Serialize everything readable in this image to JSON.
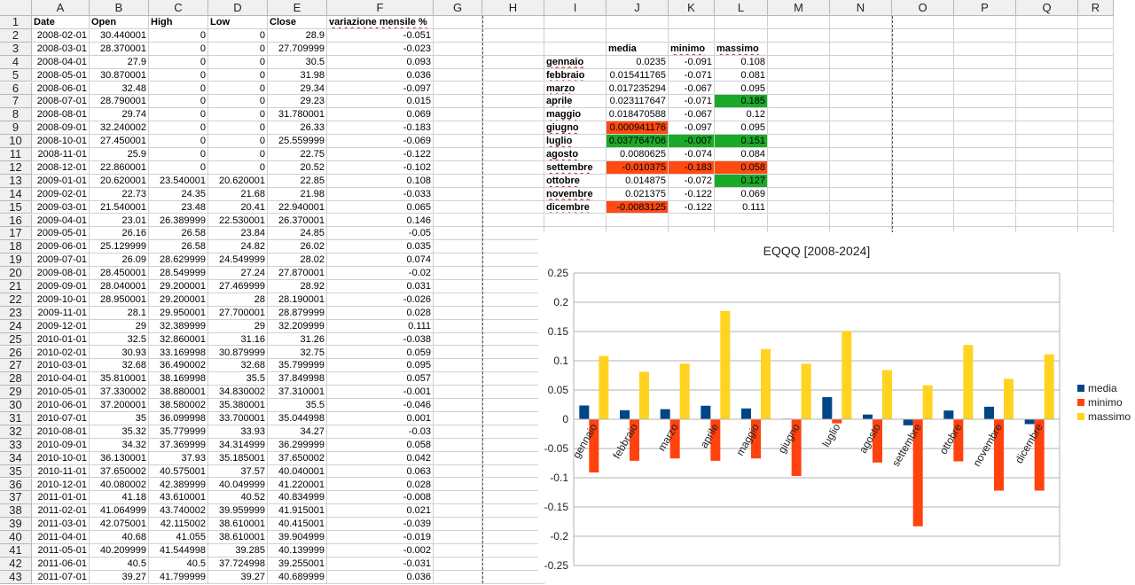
{
  "columns": [
    "A",
    "B",
    "C",
    "D",
    "E",
    "F",
    "G",
    "H",
    "I",
    "J",
    "K",
    "L",
    "M",
    "N",
    "O",
    "P",
    "Q",
    "R"
  ],
  "column_widths": [
    65,
    67,
    67,
    67,
    67,
    120,
    55,
    70,
    70,
    70,
    52,
    60,
    70,
    70,
    70,
    70,
    70,
    40
  ],
  "row_numbers": [
    "1",
    "2",
    "3",
    "4",
    "5",
    "6",
    "7",
    "8",
    "9",
    "10",
    "11",
    "12",
    "13",
    "14",
    "15",
    "16",
    "17",
    "18",
    "19",
    "20",
    "21",
    "22",
    "23",
    "24",
    "25",
    "26",
    "27",
    "28",
    "29",
    "30",
    "31",
    "32",
    "33",
    "34",
    "35",
    "36",
    "37",
    "38",
    "39",
    "40",
    "41",
    "42",
    "43"
  ],
  "headers": [
    "Date",
    "Open",
    "High",
    "Low",
    "Close",
    "variazione mensile %"
  ],
  "rows": [
    [
      "2008-02-01",
      "30.440001",
      "0",
      "0",
      "28.9",
      "-0.051"
    ],
    [
      "2008-03-01",
      "28.370001",
      "0",
      "0",
      "27.709999",
      "-0.023"
    ],
    [
      "2008-04-01",
      "27.9",
      "0",
      "0",
      "30.5",
      "0.093"
    ],
    [
      "2008-05-01",
      "30.870001",
      "0",
      "0",
      "31.98",
      "0.036"
    ],
    [
      "2008-06-01",
      "32.48",
      "0",
      "0",
      "29.34",
      "-0.097"
    ],
    [
      "2008-07-01",
      "28.790001",
      "0",
      "0",
      "29.23",
      "0.015"
    ],
    [
      "2008-08-01",
      "29.74",
      "0",
      "0",
      "31.780001",
      "0.069"
    ],
    [
      "2008-09-01",
      "32.240002",
      "0",
      "0",
      "26.33",
      "-0.183"
    ],
    [
      "2008-10-01",
      "27.450001",
      "0",
      "0",
      "25.559999",
      "-0.069"
    ],
    [
      "2008-11-01",
      "25.9",
      "0",
      "0",
      "22.75",
      "-0.122"
    ],
    [
      "2008-12-01",
      "22.860001",
      "0",
      "0",
      "20.52",
      "-0.102"
    ],
    [
      "2009-01-01",
      "20.620001",
      "23.540001",
      "20.620001",
      "22.85",
      "0.108"
    ],
    [
      "2009-02-01",
      "22.73",
      "24.35",
      "21.68",
      "21.98",
      "-0.033"
    ],
    [
      "2009-03-01",
      "21.540001",
      "23.48",
      "20.41",
      "22.940001",
      "0.065"
    ],
    [
      "2009-04-01",
      "23.01",
      "26.389999",
      "22.530001",
      "26.370001",
      "0.146"
    ],
    [
      "2009-05-01",
      "26.16",
      "26.58",
      "23.84",
      "24.85",
      "-0.05"
    ],
    [
      "2009-06-01",
      "25.129999",
      "26.58",
      "24.82",
      "26.02",
      "0.035"
    ],
    [
      "2009-07-01",
      "26.09",
      "28.629999",
      "24.549999",
      "28.02",
      "0.074"
    ],
    [
      "2009-08-01",
      "28.450001",
      "28.549999",
      "27.24",
      "27.870001",
      "-0.02"
    ],
    [
      "2009-09-01",
      "28.040001",
      "29.200001",
      "27.469999",
      "28.92",
      "0.031"
    ],
    [
      "2009-10-01",
      "28.950001",
      "29.200001",
      "28",
      "28.190001",
      "-0.026"
    ],
    [
      "2009-11-01",
      "28.1",
      "29.950001",
      "27.700001",
      "28.879999",
      "0.028"
    ],
    [
      "2009-12-01",
      "29",
      "32.389999",
      "29",
      "32.209999",
      "0.111"
    ],
    [
      "2010-01-01",
      "32.5",
      "32.860001",
      "31.16",
      "31.26",
      "-0.038"
    ],
    [
      "2010-02-01",
      "30.93",
      "33.169998",
      "30.879999",
      "32.75",
      "0.059"
    ],
    [
      "2010-03-01",
      "32.68",
      "36.490002",
      "32.68",
      "35.799999",
      "0.095"
    ],
    [
      "2010-04-01",
      "35.810001",
      "38.169998",
      "35.5",
      "37.849998",
      "0.057"
    ],
    [
      "2010-05-01",
      "37.330002",
      "38.880001",
      "34.830002",
      "37.310001",
      "-0.001"
    ],
    [
      "2010-06-01",
      "37.200001",
      "38.580002",
      "35.380001",
      "35.5",
      "-0.046"
    ],
    [
      "2010-07-01",
      "35",
      "36.099998",
      "33.700001",
      "35.044998",
      "0.001"
    ],
    [
      "2010-08-01",
      "35.32",
      "35.779999",
      "33.93",
      "34.27",
      "-0.03"
    ],
    [
      "2010-09-01",
      "34.32",
      "37.369999",
      "34.314999",
      "36.299999",
      "0.058"
    ],
    [
      "2010-10-01",
      "36.130001",
      "37.93",
      "35.185001",
      "37.650002",
      "0.042"
    ],
    [
      "2010-11-01",
      "37.650002",
      "40.575001",
      "37.57",
      "40.040001",
      "0.063"
    ],
    [
      "2010-12-01",
      "40.080002",
      "42.389999",
      "40.049999",
      "41.220001",
      "0.028"
    ],
    [
      "2011-01-01",
      "41.18",
      "43.610001",
      "40.52",
      "40.834999",
      "-0.008"
    ],
    [
      "2011-02-01",
      "41.064999",
      "43.740002",
      "39.959999",
      "41.915001",
      "0.021"
    ],
    [
      "2011-03-01",
      "42.075001",
      "42.115002",
      "38.610001",
      "40.415001",
      "-0.039"
    ],
    [
      "2011-04-01",
      "40.68",
      "41.055",
      "38.610001",
      "39.904999",
      "-0.019"
    ],
    [
      "2011-05-01",
      "40.209999",
      "41.544998",
      "39.285",
      "40.139999",
      "-0.002"
    ],
    [
      "2011-06-01",
      "40.5",
      "40.5",
      "37.724998",
      "39.255001",
      "-0.031"
    ],
    [
      "2011-07-01",
      "39.27",
      "41.799999",
      "39.27",
      "40.689999",
      "0.036"
    ]
  ],
  "summary": {
    "headers": [
      "media",
      "minimo",
      "massimo"
    ],
    "months": [
      "gennaio",
      "febbraio",
      "marzo",
      "aprile",
      "maggio",
      "giugno",
      "luglio",
      "agosto",
      "settembre",
      "ottobre",
      "novembre",
      "dicembre"
    ],
    "media": [
      "0.0235",
      "0.015411765",
      "0.017235294",
      "0.023117647",
      "0.018470588",
      "0.000941176",
      "0.037764706",
      "0.0080625",
      "-0.010375",
      "0.014875",
      "0.021375",
      "-0.0083125"
    ],
    "minimo": [
      "-0.091",
      "-0.071",
      "-0.067",
      "-0.071",
      "-0.067",
      "-0.097",
      "-0.007",
      "-0.074",
      "-0.183",
      "-0.072",
      "-0.122",
      "-0.122"
    ],
    "massimo": [
      "0.108",
      "0.081",
      "0.095",
      "0.185",
      "0.12",
      "0.095",
      "0.151",
      "0.084",
      "0.058",
      "0.127",
      "0.069",
      "0.111"
    ],
    "highlights": {
      "red": "#ff4a12",
      "green": "#1aaa2a",
      "media_red_rows": [
        5,
        8,
        11
      ],
      "media_green_rows": [
        6
      ],
      "minimo_red_rows": [
        8
      ],
      "minimo_green_rows": [
        6
      ],
      "massimo_red_rows": [
        8
      ],
      "massimo_green_rows": [
        3,
        6,
        9
      ]
    }
  },
  "chart_data": {
    "type": "bar",
    "title": "EQQQ [2008-2024]",
    "categories": [
      "gennaio",
      "febbraio",
      "marzo",
      "aprile",
      "maggio",
      "giugno",
      "luglio",
      "agosto",
      "settembre",
      "ottobre",
      "novembre",
      "dicembre"
    ],
    "series": [
      {
        "name": "media",
        "color": "#004586",
        "values": [
          0.0235,
          0.015411765,
          0.017235294,
          0.023117647,
          0.018470588,
          0.000941176,
          0.037764706,
          0.0080625,
          -0.010375,
          0.014875,
          0.021375,
          -0.0083125
        ]
      },
      {
        "name": "minimo",
        "color": "#ff420e",
        "values": [
          -0.091,
          -0.071,
          -0.067,
          -0.071,
          -0.067,
          -0.097,
          -0.007,
          -0.074,
          -0.183,
          -0.072,
          -0.122,
          -0.122
        ]
      },
      {
        "name": "massimo",
        "color": "#ffd320",
        "values": [
          0.108,
          0.081,
          0.095,
          0.185,
          0.12,
          0.095,
          0.151,
          0.084,
          0.058,
          0.127,
          0.069,
          0.111
        ]
      }
    ],
    "ylim": [
      -0.25,
      0.25
    ],
    "yticks": [
      "0.25",
      "0.2",
      "0.15",
      "0.1",
      "0.05",
      "0",
      "-0.05",
      "-0.1",
      "-0.15",
      "-0.2",
      "-0.25"
    ],
    "grid": true,
    "legend": "right"
  }
}
